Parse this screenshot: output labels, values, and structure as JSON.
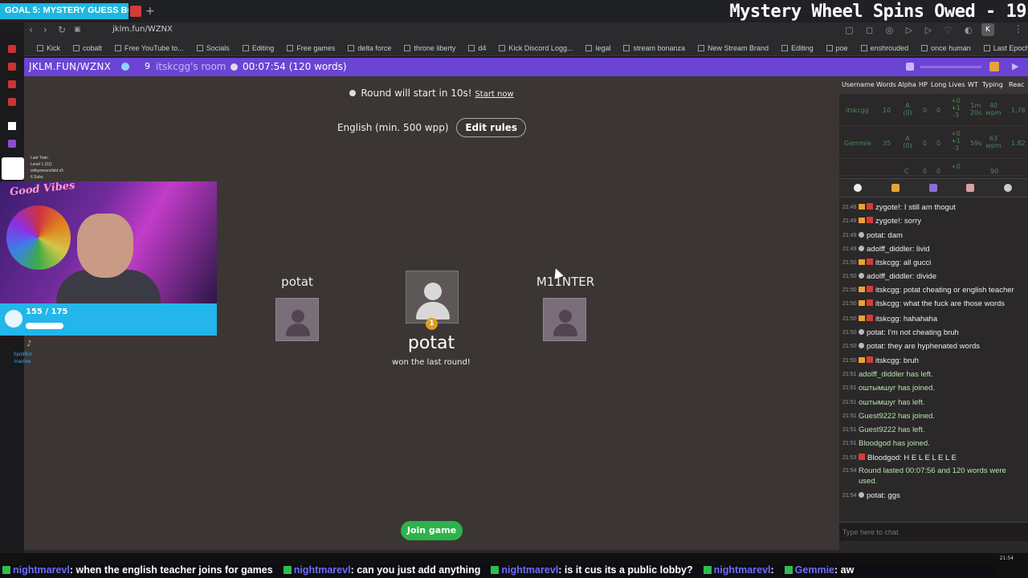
{
  "stream_overlay": {
    "goal_tab": "GOAL 5: MYSTERY GUESS BOX",
    "title": "Mystery Wheel Spins Owed - 19",
    "cam_info_lines": [
      "Last Train",
      "Level 1  (31)",
      "milkymoonchild x5",
      "6 Subs"
    ],
    "good_vibes": "Good Vibes",
    "goal_progress_text": "155 / 175",
    "goal_progress_fraction": 0.886,
    "spotibot": "SpotiBot",
    "spotibot_status": "Inactive"
  },
  "browser": {
    "url": "jklm.fun/WZNX",
    "bookmarks": [
      "Kick",
      "cobalt",
      "Free YouTube to...",
      "Socials",
      "Editing",
      "Free games",
      "delta force",
      "throne liberty",
      "d4",
      "Kick Discord Logg...",
      "legal",
      "stream bonanza",
      "New Stream Brand",
      "Editing",
      "poe",
      "enshrouded",
      "once human",
      "Last Epoch Patch..."
    ],
    "profile_letter": "K"
  },
  "header": {
    "room_url": "JKLM.FUN/WZNX",
    "player_count": "9",
    "room_name": "itskcgg's room",
    "timer": "00:07:54 (120 words)"
  },
  "game": {
    "round_message": "Round will start in 10s!",
    "start_now": "Start now",
    "rules_text": "English (min. 500 wpp)",
    "edit_rules": "Edit rules",
    "players": [
      {
        "name": "potat"
      },
      {
        "name": "M11NTER"
      }
    ],
    "winner": {
      "name": "potat",
      "rank": "1",
      "subtitle": "won the last round!"
    },
    "join_button": "Join game"
  },
  "scoreboard": {
    "headers": [
      "Username",
      "Words",
      "Alpha",
      "HP",
      "Long",
      "Lives",
      "WT",
      "Typing",
      "Reac"
    ],
    "rows": [
      {
        "username": "itskcgg",
        "words": "10",
        "alpha": "A (0)",
        "hp": "0",
        "long": "0",
        "lives": "+0 +1 -3",
        "wt": "1m 20s",
        "typing": "40 wpm",
        "reac": "1.76"
      },
      {
        "username": "Gemmie",
        "words": "35",
        "alpha": "A (0)",
        "hp": "0",
        "long": "0",
        "lives": "+0 +1 -3",
        "wt": "59s",
        "typing": "63 wpm",
        "reac": "1.82"
      },
      {
        "username": "",
        "words": "",
        "alpha": "C",
        "hp": "0",
        "long": "0",
        "lives": "+0",
        "wt": "",
        "typing": "90",
        "reac": ""
      }
    ]
  },
  "chat": {
    "messages": [
      {
        "time": "21:49",
        "badge": "crown",
        "user": "zygote!",
        "text": ": I still am thogut"
      },
      {
        "time": "21:49",
        "badge": "crown",
        "user": "zygote!",
        "text": ": sorry"
      },
      {
        "time": "21:49",
        "badge": "dot",
        "user": "potat",
        "text": ": dam"
      },
      {
        "time": "21:49",
        "badge": "dot",
        "user": "adolff_diddler",
        "text": ": livid"
      },
      {
        "time": "21:50",
        "badge": "crown",
        "user": "itskcgg",
        "text": ": all gucci"
      },
      {
        "time": "21:50",
        "badge": "dot",
        "user": "adolff_diddler",
        "text": ": divide"
      },
      {
        "time": "21:50",
        "badge": "crown",
        "user": "itskcgg",
        "text": ": potat cheating or english teacher",
        "wrap": true
      },
      {
        "time": "21:50",
        "badge": "crown",
        "user": "itskcgg",
        "text": ": what the fuck are those words",
        "wrap": true
      },
      {
        "time": "21:50",
        "badge": "crown",
        "user": "itskcgg",
        "text": ": hahahaha"
      },
      {
        "time": "21:50",
        "badge": "dot",
        "user": "potat",
        "text": ": I'm not cheating bruh"
      },
      {
        "time": "21:50",
        "badge": "dot",
        "user": "potat",
        "text": ": they are hyphenated words"
      },
      {
        "time": "21:50",
        "badge": "crown",
        "user": "itskcgg",
        "text": ": bruh"
      },
      {
        "time": "21:51",
        "badge": "none",
        "user": "",
        "text": "adolff_diddler has left.",
        "system": true
      },
      {
        "time": "21:51",
        "badge": "none",
        "user": "",
        "text": "оштымшуг has joined.",
        "system": true
      },
      {
        "time": "21:51",
        "badge": "none",
        "user": "",
        "text": "оштымшуг has left.",
        "system": true
      },
      {
        "time": "21:51",
        "badge": "none",
        "user": "",
        "text": "Guest9222 has joined.",
        "system": true
      },
      {
        "time": "21:51",
        "badge": "none",
        "user": "",
        "text": "Guest9222 has left.",
        "system": true
      },
      {
        "time": "21:51",
        "badge": "none",
        "user": "",
        "text": "Bloodgod has joined.",
        "system": true
      },
      {
        "time": "21:53",
        "badge": "red",
        "user": "Bloodgod",
        "text": ": H E L E L E L E"
      },
      {
        "time": "21:54",
        "badge": "none",
        "user": "",
        "text": "Round lasted 00:07:56 and 120 words were used.",
        "system": true,
        "wrap": true
      },
      {
        "time": "21:54",
        "badge": "dot",
        "user": "potat",
        "text": ": ggs"
      }
    ],
    "input_placeholder": "Type here to chat"
  },
  "ticker": {
    "items": [
      {
        "user": "nightmarevl",
        "text": ": when the english teacher joins for games"
      },
      {
        "user": "nightmarevl",
        "text": ": can you just add anything"
      },
      {
        "user": "nightmarevl",
        "text": ": is it cus its a public lobby?"
      },
      {
        "user": "nightmarevl",
        "text": ":"
      },
      {
        "user": "Gemmie",
        "text": ": aw"
      }
    ]
  },
  "taskbar": {
    "clock": "21:54"
  }
}
